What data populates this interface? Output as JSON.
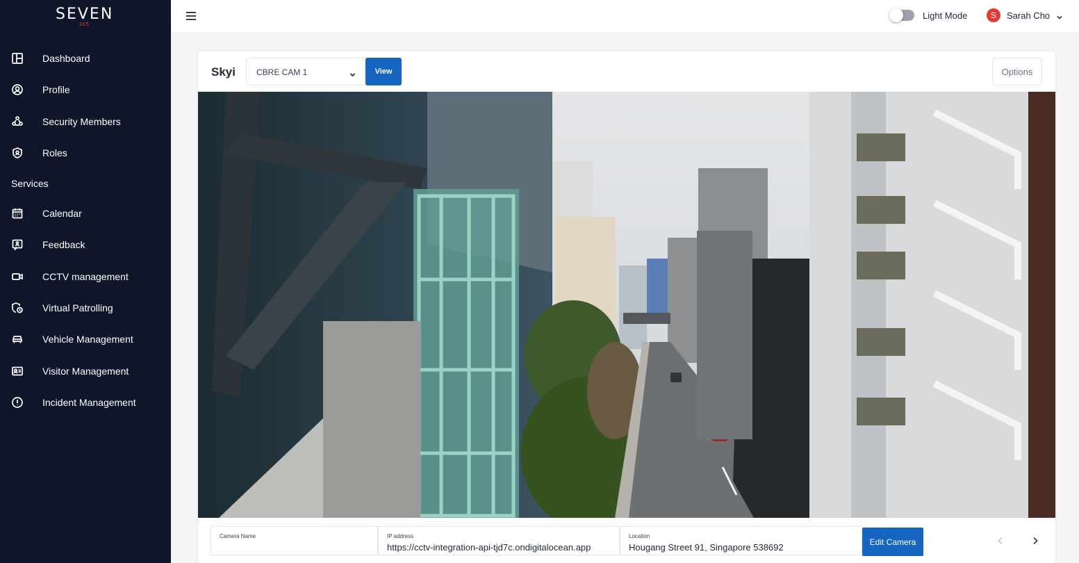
{
  "brand": {
    "logo_text": "SEVEN",
    "logo_sub": "365"
  },
  "sidebar": {
    "items": [
      {
        "label": "Dashboard",
        "icon": "dashboard-icon"
      },
      {
        "label": "Profile",
        "icon": "profile-icon"
      },
      {
        "label": "Security Members",
        "icon": "security-members-icon"
      },
      {
        "label": "Roles",
        "icon": "shield-icon"
      }
    ],
    "section_label": "Services",
    "services": [
      {
        "label": "Calendar",
        "icon": "calendar-icon"
      },
      {
        "label": "Feedback",
        "icon": "feedback-icon"
      },
      {
        "label": "CCTV management",
        "icon": "video-camera-icon"
      },
      {
        "label": "Virtual Patrolling",
        "icon": "patrol-icon"
      },
      {
        "label": "Vehicle Management",
        "icon": "car-icon"
      },
      {
        "label": "Visitor Management",
        "icon": "id-card-icon"
      },
      {
        "label": "Incident Management",
        "icon": "alert-circle-icon"
      }
    ]
  },
  "topbar": {
    "mode_label": "Light Mode",
    "mode_on": false,
    "user": {
      "initial": "S",
      "name": "Sarah Cho"
    }
  },
  "camera": {
    "title": "Skyi",
    "selected": "CBRE CAM 1",
    "view_label": "View",
    "options_label": "Options",
    "fields": {
      "name_label": "Camera Name",
      "name_value": "",
      "ip_label": "IP address",
      "ip_value": "https://cctv-integration-api-tjd7c.ondigitalocean.app",
      "location_label": "Location",
      "location_value": "Hougang Street 91, Singapore 538692"
    },
    "edit_label": "Edit Camera"
  },
  "colors": {
    "sidebar_bg": "#0f1629",
    "accent": "#1565c0",
    "avatar": "#e53935"
  }
}
